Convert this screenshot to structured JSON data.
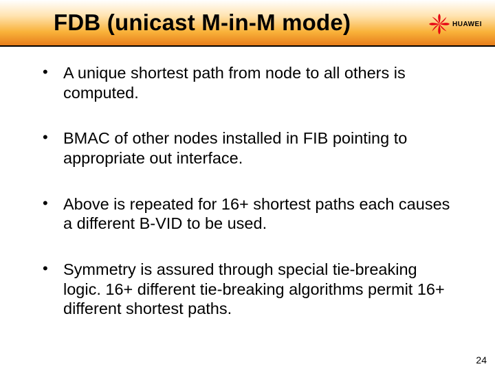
{
  "header": {
    "title": "FDB (unicast M-in-M mode)",
    "logo_text": "HUAWEI"
  },
  "bullets": [
    "A unique shortest path from node to all others is computed.",
    "BMAC of other nodes installed in FIB pointing to appropriate out interface.",
    "Above is repeated for 16+ shortest paths each causes a different B-VID to be used.",
    "Symmetry is assured through special tie-breaking logic. 16+ different tie-breaking algorithms permit 16+ different shortest paths."
  ],
  "page_number": "24"
}
